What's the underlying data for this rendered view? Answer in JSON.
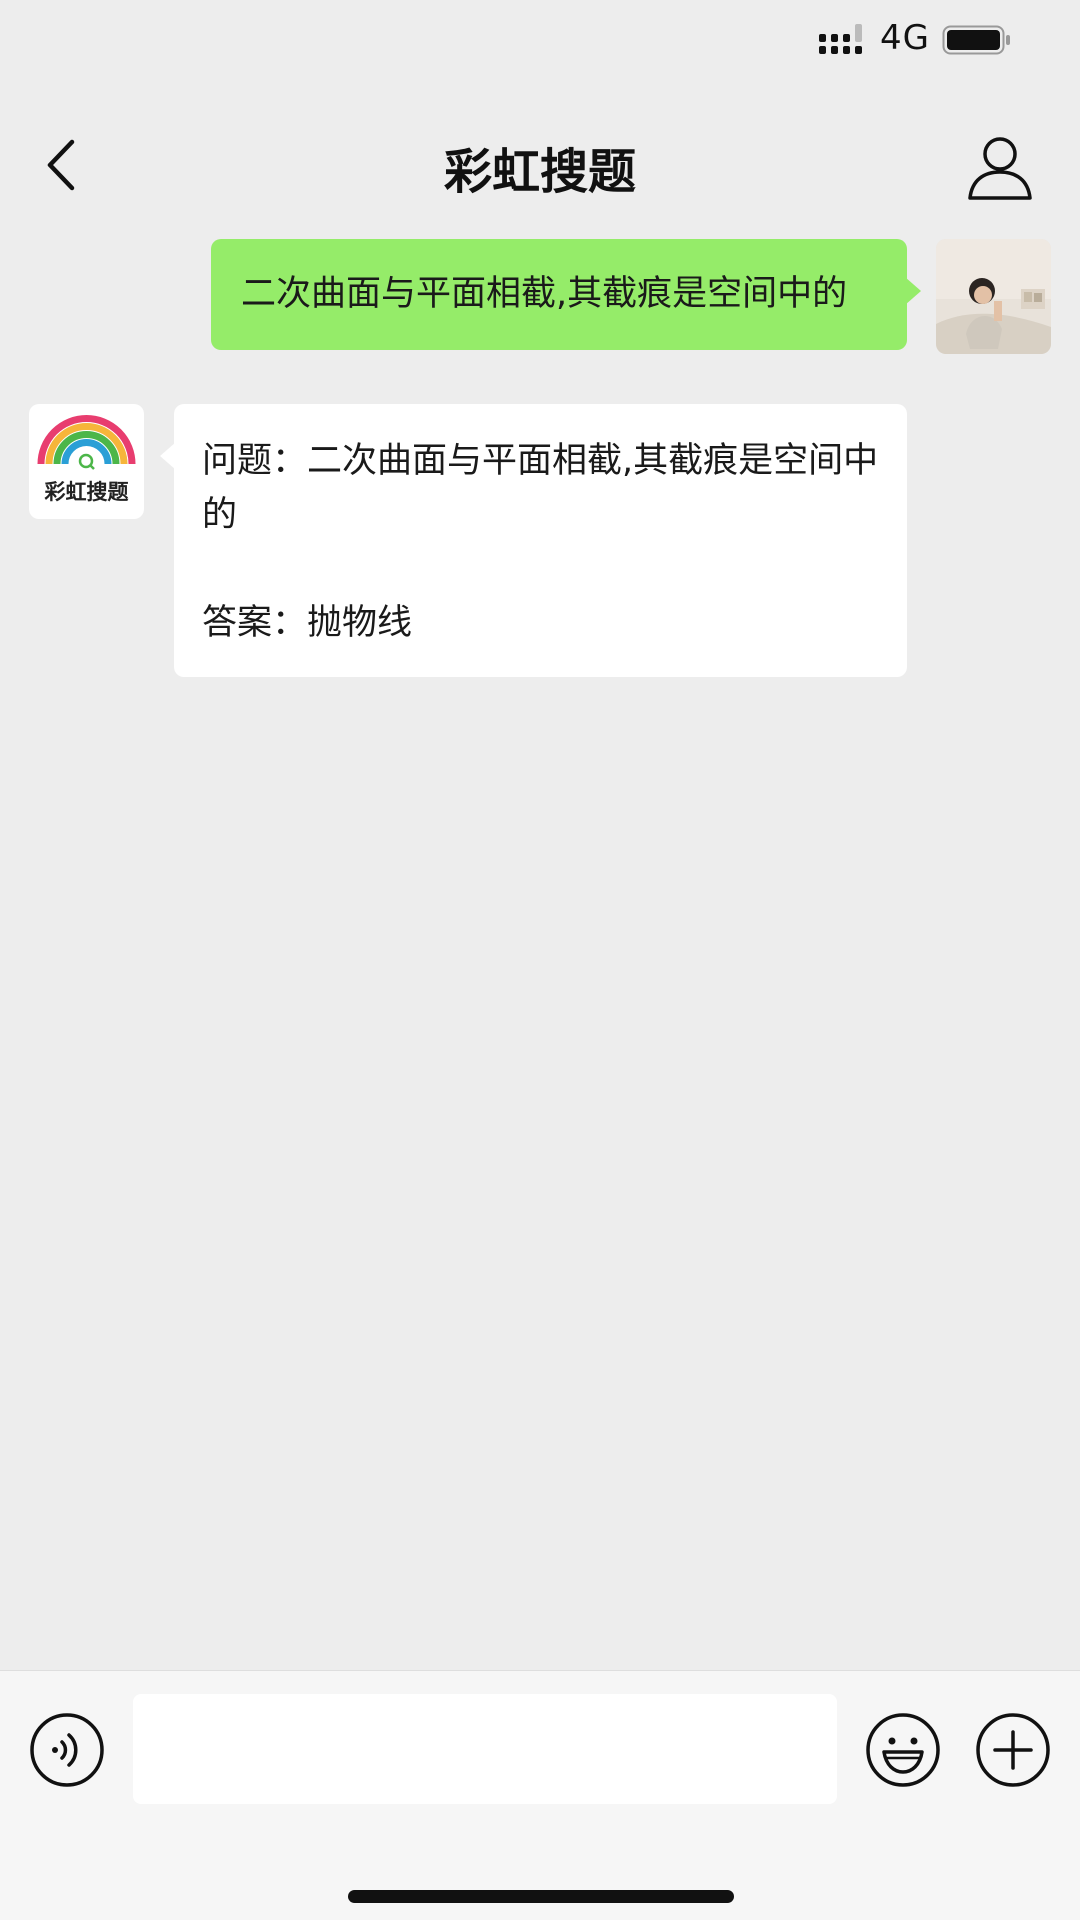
{
  "status_bar": {
    "network": "4G",
    "icons": [
      "signal-icon",
      "battery-icon"
    ]
  },
  "nav": {
    "title": "彩虹搜题",
    "icons": [
      "back-icon",
      "profile-icon"
    ]
  },
  "messages": {
    "user": {
      "text": "二次曲面与平面相截,其截痕是空间中的",
      "bubble_color": "#95ec69"
    },
    "bot": {
      "logo_text": "彩虹搜题",
      "question": "问题：二次曲面与平面相截,其截痕是空间中的",
      "answer": "答案：抛物线"
    }
  },
  "input_bar": {
    "placeholder": "",
    "icons": [
      "voice-icon",
      "emoji-icon",
      "plus-icon"
    ]
  },
  "colors": {
    "background": "#ededed",
    "user_bubble": "#95ec69",
    "bot_bubble": "#ffffff"
  }
}
